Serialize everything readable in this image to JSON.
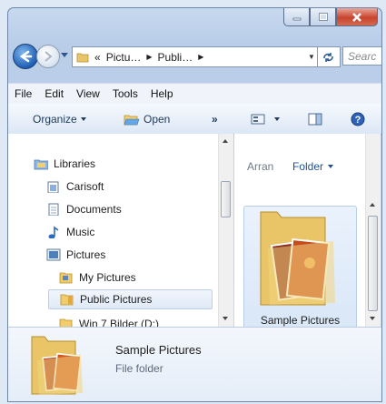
{
  "address": {
    "crumbs": [
      "Pictu…",
      "Publi…"
    ],
    "prefix": "«"
  },
  "search": {
    "placeholder": "Searc"
  },
  "menu": [
    "File",
    "Edit",
    "View",
    "Tools",
    "Help"
  ],
  "toolbar": {
    "organize": "Organize",
    "open": "Open",
    "more": "»"
  },
  "nav_tree": [
    {
      "label": "Libraries",
      "icon": "libraries-icon"
    },
    {
      "label": "Carisoft",
      "icon": "documents-icon"
    },
    {
      "label": "Documents",
      "icon": "documents-icon"
    },
    {
      "label": "Music",
      "icon": "music-icon"
    },
    {
      "label": "Pictures",
      "icon": "pictures-icon"
    },
    {
      "label": "My Pictures",
      "icon": "folder-icon"
    },
    {
      "label": "Public Pictures",
      "icon": "folder-icon",
      "selected": true
    },
    {
      "label": "Win 7 Bilder (D:)",
      "icon": "folder-icon"
    }
  ],
  "content": {
    "arrange_label": "Arran",
    "arrange_value": "Folder"
  },
  "items": [
    {
      "label": "Sample Pictures"
    }
  ],
  "details": {
    "name": "Sample Pictures",
    "type": "File folder"
  },
  "colors": {
    "accent": "#1f5fb4",
    "selection": "#dfe9f6",
    "close": "#c8442d"
  }
}
